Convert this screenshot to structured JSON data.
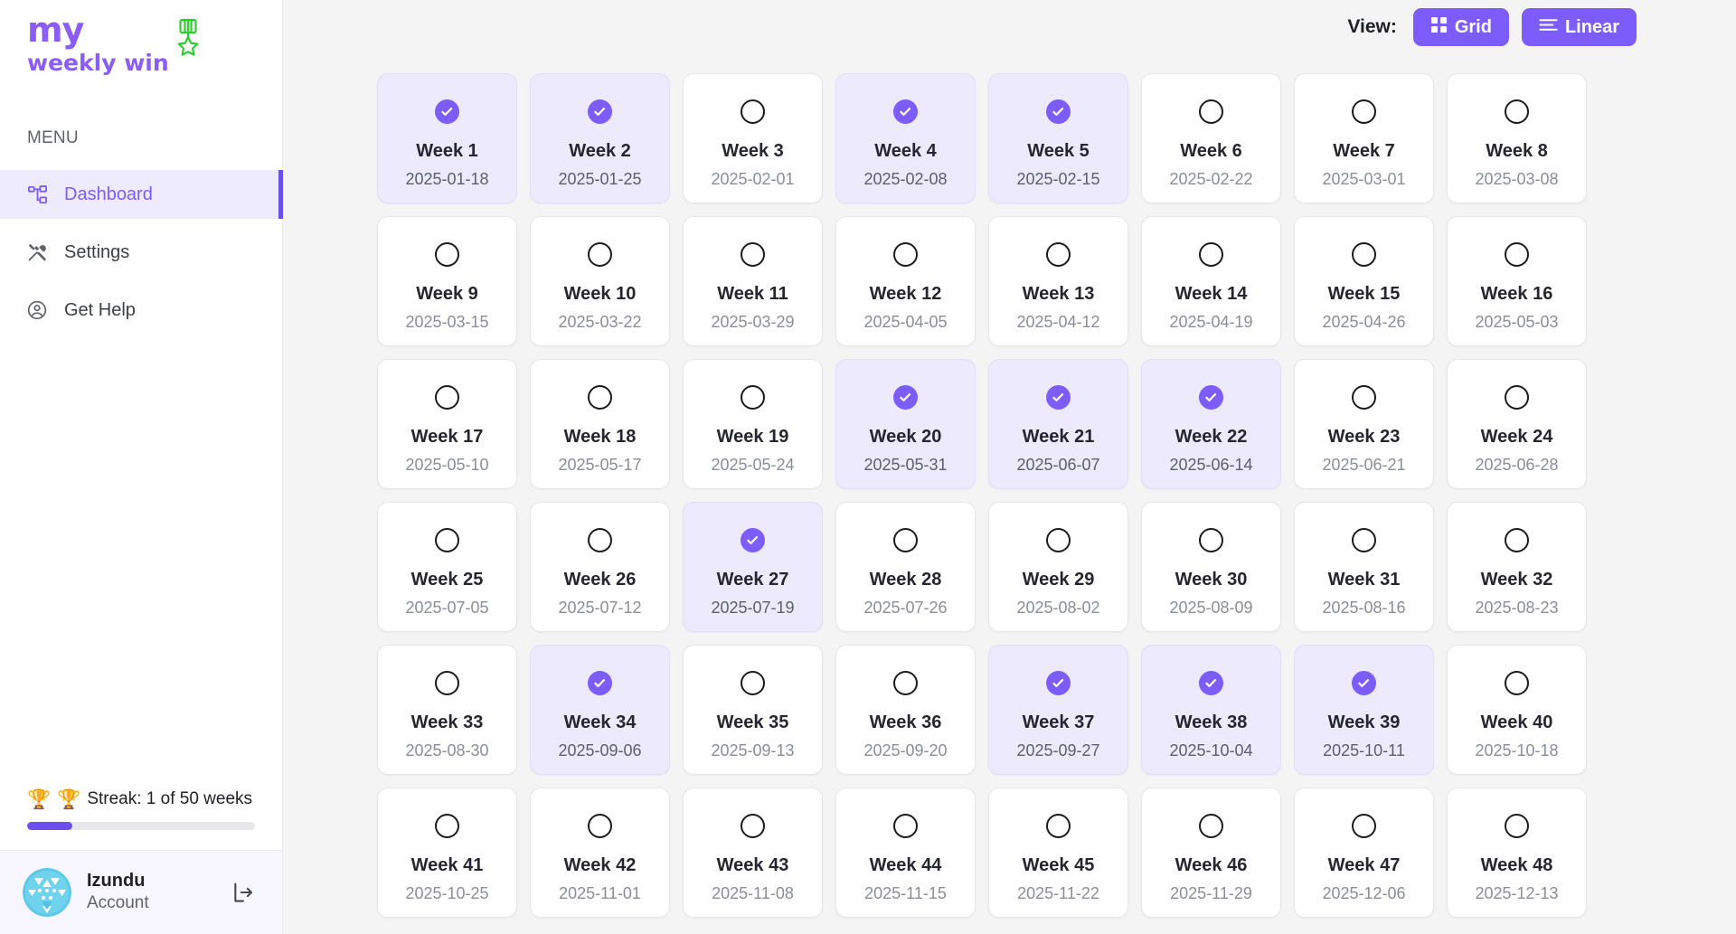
{
  "brand": {
    "line1": "my",
    "line2": "weekly win",
    "medal_icon": "medal-icon",
    "accent_color": "#8b5cf6",
    "medal_color": "#2fce2f"
  },
  "sidebar": {
    "menu_label": "MENU",
    "items": [
      {
        "label": "Dashboard",
        "icon": "schema-icon",
        "active": true
      },
      {
        "label": "Settings",
        "icon": "tools-icon",
        "active": false
      },
      {
        "label": "Get Help",
        "icon": "account-circle-icon",
        "active": false
      }
    ],
    "streak": {
      "trophy_left": "🏆",
      "trophy_right": "🏆",
      "text": "Streak: 1 of 50 weeks",
      "current": 1,
      "total": 50,
      "progress_percent": 20,
      "fill_color": "#6c4ff0"
    },
    "account": {
      "name": "Izundu",
      "subtitle": "Account",
      "avatar_icon": "avatar-identicon",
      "logout_icon": "logout-icon"
    }
  },
  "topbar": {
    "view_label": "View:",
    "buttons": [
      {
        "label": "Grid",
        "icon": "grid-icon",
        "active": true
      },
      {
        "label": "Linear",
        "icon": "linear-list-icon",
        "active": false
      }
    ],
    "button_color": "#7c5cfa"
  },
  "grid": {
    "columns": 8,
    "checked_color": "#7c5cfa",
    "checked_bg": "#edeafd",
    "weeks": [
      {
        "title": "Week 1",
        "date": "2025-01-18",
        "done": true
      },
      {
        "title": "Week 2",
        "date": "2025-01-25",
        "done": true
      },
      {
        "title": "Week 3",
        "date": "2025-02-01",
        "done": false
      },
      {
        "title": "Week 4",
        "date": "2025-02-08",
        "done": true
      },
      {
        "title": "Week 5",
        "date": "2025-02-15",
        "done": true
      },
      {
        "title": "Week 6",
        "date": "2025-02-22",
        "done": false
      },
      {
        "title": "Week 7",
        "date": "2025-03-01",
        "done": false
      },
      {
        "title": "Week 8",
        "date": "2025-03-08",
        "done": false
      },
      {
        "title": "Week 9",
        "date": "2025-03-15",
        "done": false
      },
      {
        "title": "Week 10",
        "date": "2025-03-22",
        "done": false
      },
      {
        "title": "Week 11",
        "date": "2025-03-29",
        "done": false
      },
      {
        "title": "Week 12",
        "date": "2025-04-05",
        "done": false
      },
      {
        "title": "Week 13",
        "date": "2025-04-12",
        "done": false
      },
      {
        "title": "Week 14",
        "date": "2025-04-19",
        "done": false
      },
      {
        "title": "Week 15",
        "date": "2025-04-26",
        "done": false
      },
      {
        "title": "Week 16",
        "date": "2025-05-03",
        "done": false
      },
      {
        "title": "Week 17",
        "date": "2025-05-10",
        "done": false
      },
      {
        "title": "Week 18",
        "date": "2025-05-17",
        "done": false
      },
      {
        "title": "Week 19",
        "date": "2025-05-24",
        "done": false
      },
      {
        "title": "Week 20",
        "date": "2025-05-31",
        "done": true
      },
      {
        "title": "Week 21",
        "date": "2025-06-07",
        "done": true
      },
      {
        "title": "Week 22",
        "date": "2025-06-14",
        "done": true
      },
      {
        "title": "Week 23",
        "date": "2025-06-21",
        "done": false
      },
      {
        "title": "Week 24",
        "date": "2025-06-28",
        "done": false
      },
      {
        "title": "Week 25",
        "date": "2025-07-05",
        "done": false
      },
      {
        "title": "Week 26",
        "date": "2025-07-12",
        "done": false
      },
      {
        "title": "Week 27",
        "date": "2025-07-19",
        "done": true
      },
      {
        "title": "Week 28",
        "date": "2025-07-26",
        "done": false
      },
      {
        "title": "Week 29",
        "date": "2025-08-02",
        "done": false
      },
      {
        "title": "Week 30",
        "date": "2025-08-09",
        "done": false
      },
      {
        "title": "Week 31",
        "date": "2025-08-16",
        "done": false
      },
      {
        "title": "Week 32",
        "date": "2025-08-23",
        "done": false
      },
      {
        "title": "Week 33",
        "date": "2025-08-30",
        "done": false
      },
      {
        "title": "Week 34",
        "date": "2025-09-06",
        "done": true
      },
      {
        "title": "Week 35",
        "date": "2025-09-13",
        "done": false
      },
      {
        "title": "Week 36",
        "date": "2025-09-20",
        "done": false
      },
      {
        "title": "Week 37",
        "date": "2025-09-27",
        "done": true
      },
      {
        "title": "Week 38",
        "date": "2025-10-04",
        "done": true
      },
      {
        "title": "Week 39",
        "date": "2025-10-11",
        "done": true
      },
      {
        "title": "Week 40",
        "date": "2025-10-18",
        "done": false
      },
      {
        "title": "Week 41",
        "date": "2025-10-25",
        "done": false
      },
      {
        "title": "Week 42",
        "date": "2025-11-01",
        "done": false
      },
      {
        "title": "Week 43",
        "date": "2025-11-08",
        "done": false
      },
      {
        "title": "Week 44",
        "date": "2025-11-15",
        "done": false
      },
      {
        "title": "Week 45",
        "date": "2025-11-22",
        "done": false
      },
      {
        "title": "Week 46",
        "date": "2025-11-29",
        "done": false
      },
      {
        "title": "Week 47",
        "date": "2025-12-06",
        "done": false
      },
      {
        "title": "Week 48",
        "date": "2025-12-13",
        "done": false
      }
    ]
  }
}
